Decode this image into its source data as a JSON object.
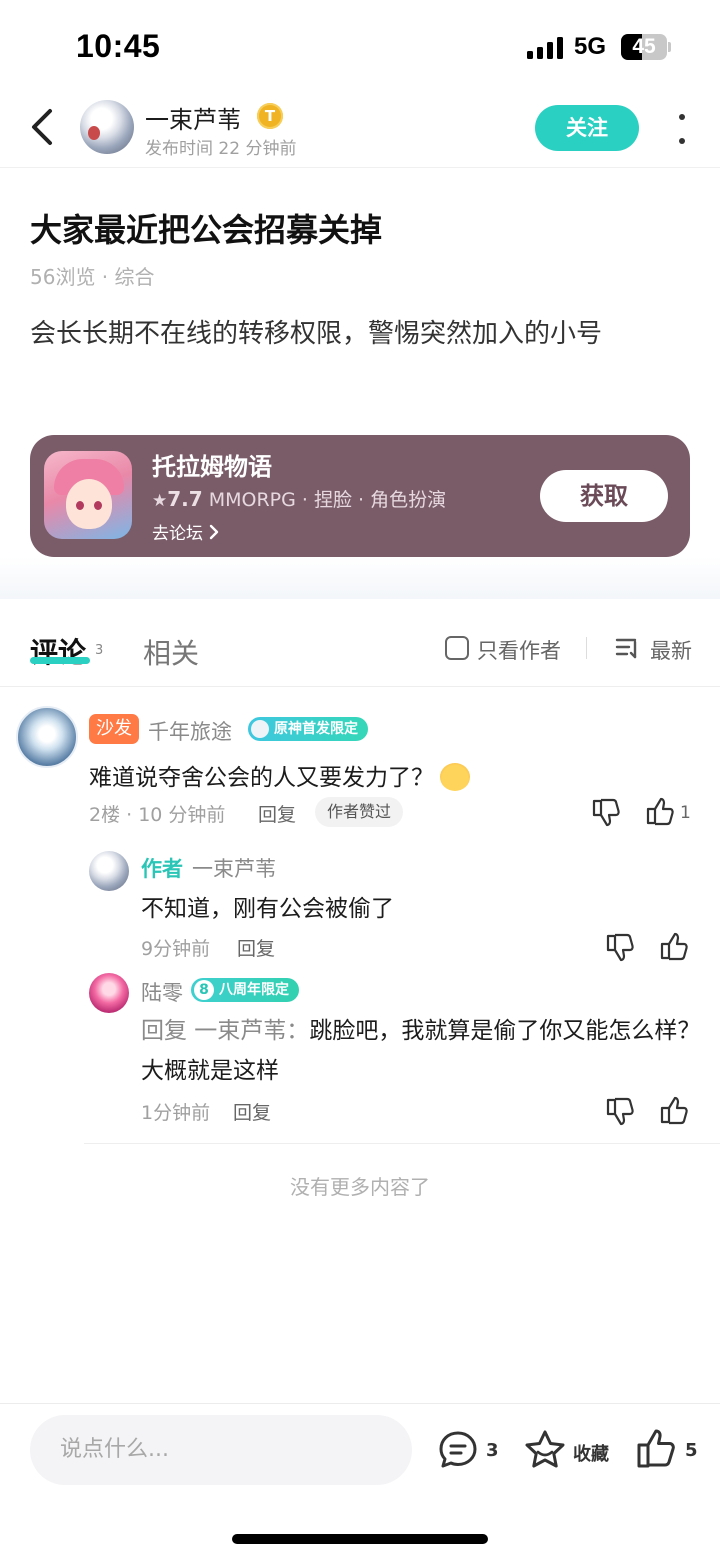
{
  "status_bar": {
    "time": "10:45",
    "network": "5G",
    "battery": "45",
    "battery_level": 0.45
  },
  "header": {
    "author_name": "一束芦苇",
    "author_badge": "T",
    "post_time": "发布时间 22 分钟前",
    "follow_label": "关注"
  },
  "post": {
    "title": "大家最近把公会招募关掉",
    "meta": "56浏览 · 综合",
    "body": "会长长期不在线的转移权限，警惕突然加入的小号"
  },
  "game_card": {
    "name": "托拉姆物语",
    "rating": "7.7",
    "tags": "MMORPG · 捏脸 · 角色扮演",
    "forum_link": "去论坛",
    "get_label": "获取",
    "bg_color": "#7a5c69"
  },
  "tabs": {
    "comments_label": "评论",
    "comments_count": "3",
    "related_label": "相关",
    "author_only_label": "只看作者",
    "sort_label": "最新",
    "accent_color": "#2ad0c1"
  },
  "comments": [
    {
      "badge": "沙发",
      "name": "千年旅途",
      "tag": "原神首发限定",
      "text": "难道说夺舍公会的人又要发力了？",
      "meta": "2楼 · 10 分钟前",
      "reply_label": "回复",
      "author_liked": "作者赞过",
      "like_count": "1",
      "replies": [
        {
          "author_label": "作者",
          "name": "一束芦苇",
          "text": "不知道，刚有公会被偷了",
          "meta": "9分钟前",
          "reply_label": "回复"
        },
        {
          "name": "陆零",
          "tag_num": "8",
          "tag": "八周年限定",
          "reply_prefix": "回复 一束芦苇：",
          "text": "跳脸吧，我就算是偷了你又能怎么样？大概就是这样",
          "meta": "1分钟前",
          "reply_label": "回复"
        }
      ]
    }
  ],
  "no_more": "没有更多内容了",
  "bottom_bar": {
    "input_placeholder": "说点什么...",
    "comment_count": "3",
    "favorite_label": "收藏",
    "like_count": "5"
  }
}
